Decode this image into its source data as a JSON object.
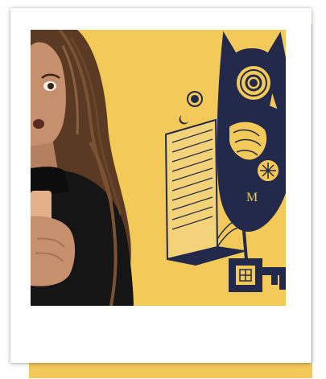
{
  "colors": {
    "accent": "#f3c95a",
    "ink": "#22294a",
    "hair": "#5a3a22",
    "skin": "#c68f6e",
    "sweater": "#151515"
  },
  "photo": {
    "subject": "surprised-woman-holding-phone",
    "illustration": "owl-key-book-tattoo-art"
  }
}
